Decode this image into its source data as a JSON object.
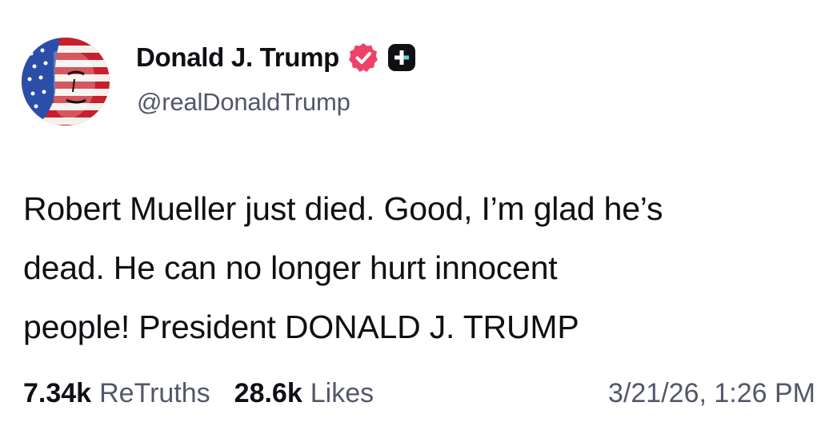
{
  "author": {
    "display_name": "Donald J. Trump",
    "handle": "@realDonaldTrump",
    "verified_icon": "verified-badge-icon",
    "app_icon": "truth-social-plus-icon",
    "verified_color": "#ef4168"
  },
  "post": {
    "lines": [
      "Robert Mueller just died. Good, I’m glad he’s",
      "dead. He can no longer hurt innocent",
      "people! President DONALD J. TRUMP"
    ]
  },
  "stats": {
    "retruths_count": "7.34k",
    "retruths_label": "ReTruths",
    "likes_count": "28.6k",
    "likes_label": "Likes",
    "timestamp": "3/21/26, 1:26 PM"
  }
}
